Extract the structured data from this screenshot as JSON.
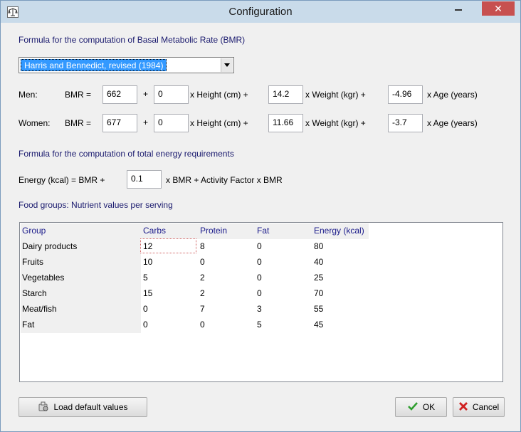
{
  "window": {
    "title": "Configuration",
    "close_glyph": "✕"
  },
  "bmr": {
    "section_title": "Formula for the computation of Basal Metabolic Rate (BMR)",
    "formula_selected": "Harris and Bennedict, revised (1984)",
    "men": {
      "label": "Men:",
      "bmr_label": "BMR =",
      "constant": "662",
      "height_coef": "0",
      "weight_coef": "14.2",
      "age_coef": "-4.96"
    },
    "women": {
      "label": "Women:",
      "bmr_label": "BMR =",
      "constant": "677",
      "height_coef": "0",
      "weight_coef": "11.66",
      "age_coef": "-3.7"
    },
    "plus": "+",
    "height_unit": "x Height (cm) +",
    "weight_unit": "x Weight (kgr) +",
    "age_unit": "x Age (years)"
  },
  "energy": {
    "section_title": "Formula for the computation of total energy requirements",
    "prefix": "Energy (kcal) = BMR +",
    "factor": "0.1",
    "suffix": "x BMR + Activity Factor x BMR"
  },
  "food": {
    "section_title": "Food groups: Nutrient values per serving",
    "columns": [
      "Group",
      "Carbs",
      "Protein",
      "Fat",
      "Energy (kcal)"
    ],
    "rows": [
      {
        "group": "Dairy products",
        "carbs": "12",
        "protein": "8",
        "fat": "0",
        "energy": "80"
      },
      {
        "group": "Fruits",
        "carbs": "10",
        "protein": "0",
        "fat": "0",
        "energy": "40"
      },
      {
        "group": "Vegetables",
        "carbs": "5",
        "protein": "2",
        "fat": "0",
        "energy": "25"
      },
      {
        "group": "Starch",
        "carbs": "15",
        "protein": "2",
        "fat": "0",
        "energy": "70"
      },
      {
        "group": "Meat/fish",
        "carbs": "0",
        "protein": "7",
        "fat": "3",
        "energy": "55"
      },
      {
        "group": "Fat",
        "carbs": "0",
        "protein": "0",
        "fat": "5",
        "energy": "45"
      }
    ]
  },
  "buttons": {
    "load_defaults": "Load default values",
    "ok": "OK",
    "cancel": "Cancel"
  },
  "icons": {
    "app": "scale-icon",
    "load": "load-icon",
    "ok": "checkmark-icon",
    "cancel": "red-x-icon"
  },
  "colors": {
    "section_title": "#1a1a6e",
    "selection": "#3399ff",
    "close_button": "#c75050",
    "ok_check": "#2e9e2e",
    "cancel_x": "#d02020"
  }
}
